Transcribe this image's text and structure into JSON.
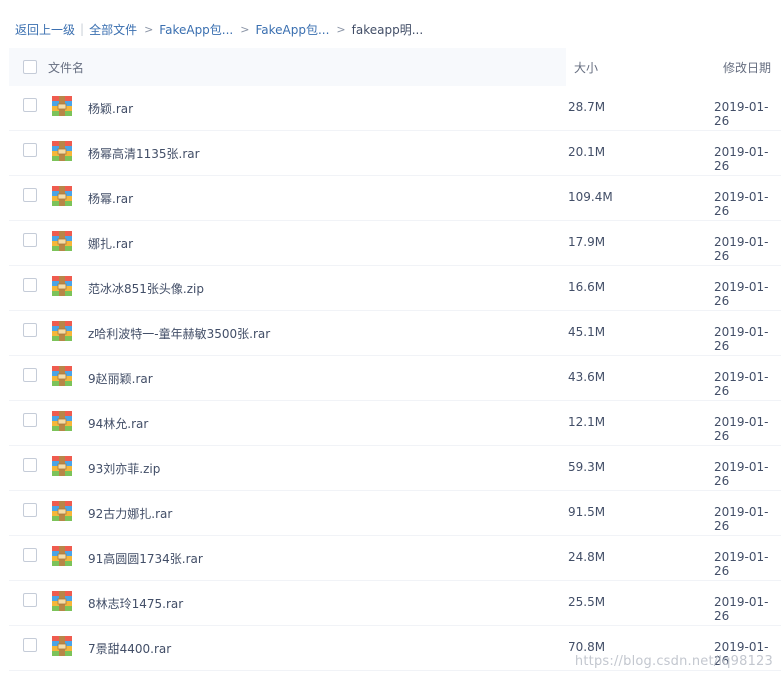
{
  "breadcrumb": {
    "back": "返回上一级",
    "separator": "|",
    "all_files": "全部文件",
    "arrow": ">",
    "level1": "FakeApp包...",
    "level2": "FakeApp包...",
    "current": "fakeapp明..."
  },
  "header": {
    "name": "文件名",
    "size": "大小",
    "date": "修改日期"
  },
  "file_icon": "archive-icon",
  "files": [
    {
      "name": "杨颖.rar",
      "size": "28.7M",
      "date": "2019-01-26"
    },
    {
      "name": "杨幂高清1135张.rar",
      "size": "20.1M",
      "date": "2019-01-26"
    },
    {
      "name": "杨幂.rar",
      "size": "109.4M",
      "date": "2019-01-26"
    },
    {
      "name": "娜扎.rar",
      "size": "17.9M",
      "date": "2019-01-26"
    },
    {
      "name": "范冰冰851张头像.zip",
      "size": "16.6M",
      "date": "2019-01-26"
    },
    {
      "name": "z哈利波特一-童年赫敏3500张.rar",
      "size": "45.1M",
      "date": "2019-01-26"
    },
    {
      "name": "9赵丽颖.rar",
      "size": "43.6M",
      "date": "2019-01-26"
    },
    {
      "name": "94林允.rar",
      "size": "12.1M",
      "date": "2019-01-26"
    },
    {
      "name": "93刘亦菲.zip",
      "size": "59.3M",
      "date": "2019-01-26"
    },
    {
      "name": "92古力娜扎.rar",
      "size": "91.5M",
      "date": "2019-01-26"
    },
    {
      "name": "91高圆圆1734张.rar",
      "size": "24.8M",
      "date": "2019-01-26"
    },
    {
      "name": "8林志玲1475.rar",
      "size": "25.5M",
      "date": "2019-01-26"
    },
    {
      "name": "7景甜4400.rar",
      "size": "70.8M",
      "date": "2019-01-26"
    }
  ],
  "watermark": "https://blog.csdn.net/lq98123"
}
